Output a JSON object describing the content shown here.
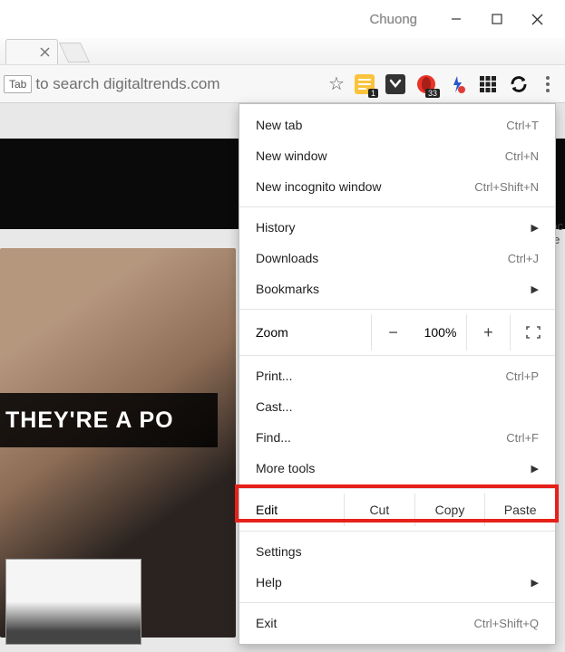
{
  "window": {
    "title": "Chuong"
  },
  "addressbar": {
    "tab_hint": "Tab",
    "text": "to search digitaltrends.com"
  },
  "extensions": {
    "notes_badge": "1",
    "opera_badge": "33"
  },
  "page": {
    "headline": "THEY'RE A PO",
    "side_partial_1": "oc",
    "side_partial_2": "le"
  },
  "menu": {
    "new_tab": {
      "label": "New tab",
      "shortcut": "Ctrl+T"
    },
    "new_window": {
      "label": "New window",
      "shortcut": "Ctrl+N"
    },
    "incognito": {
      "label": "New incognito window",
      "shortcut": "Ctrl+Shift+N"
    },
    "history": {
      "label": "History"
    },
    "downloads": {
      "label": "Downloads",
      "shortcut": "Ctrl+J"
    },
    "bookmarks": {
      "label": "Bookmarks"
    },
    "zoom": {
      "label": "Zoom",
      "level": "100%"
    },
    "print": {
      "label": "Print...",
      "shortcut": "Ctrl+P"
    },
    "cast": {
      "label": "Cast..."
    },
    "find": {
      "label": "Find...",
      "shortcut": "Ctrl+F"
    },
    "more_tools": {
      "label": "More tools"
    },
    "edit": {
      "label": "Edit",
      "cut": "Cut",
      "copy": "Copy",
      "paste": "Paste"
    },
    "settings": {
      "label": "Settings"
    },
    "help": {
      "label": "Help"
    },
    "exit": {
      "label": "Exit",
      "shortcut": "Ctrl+Shift+Q"
    }
  }
}
